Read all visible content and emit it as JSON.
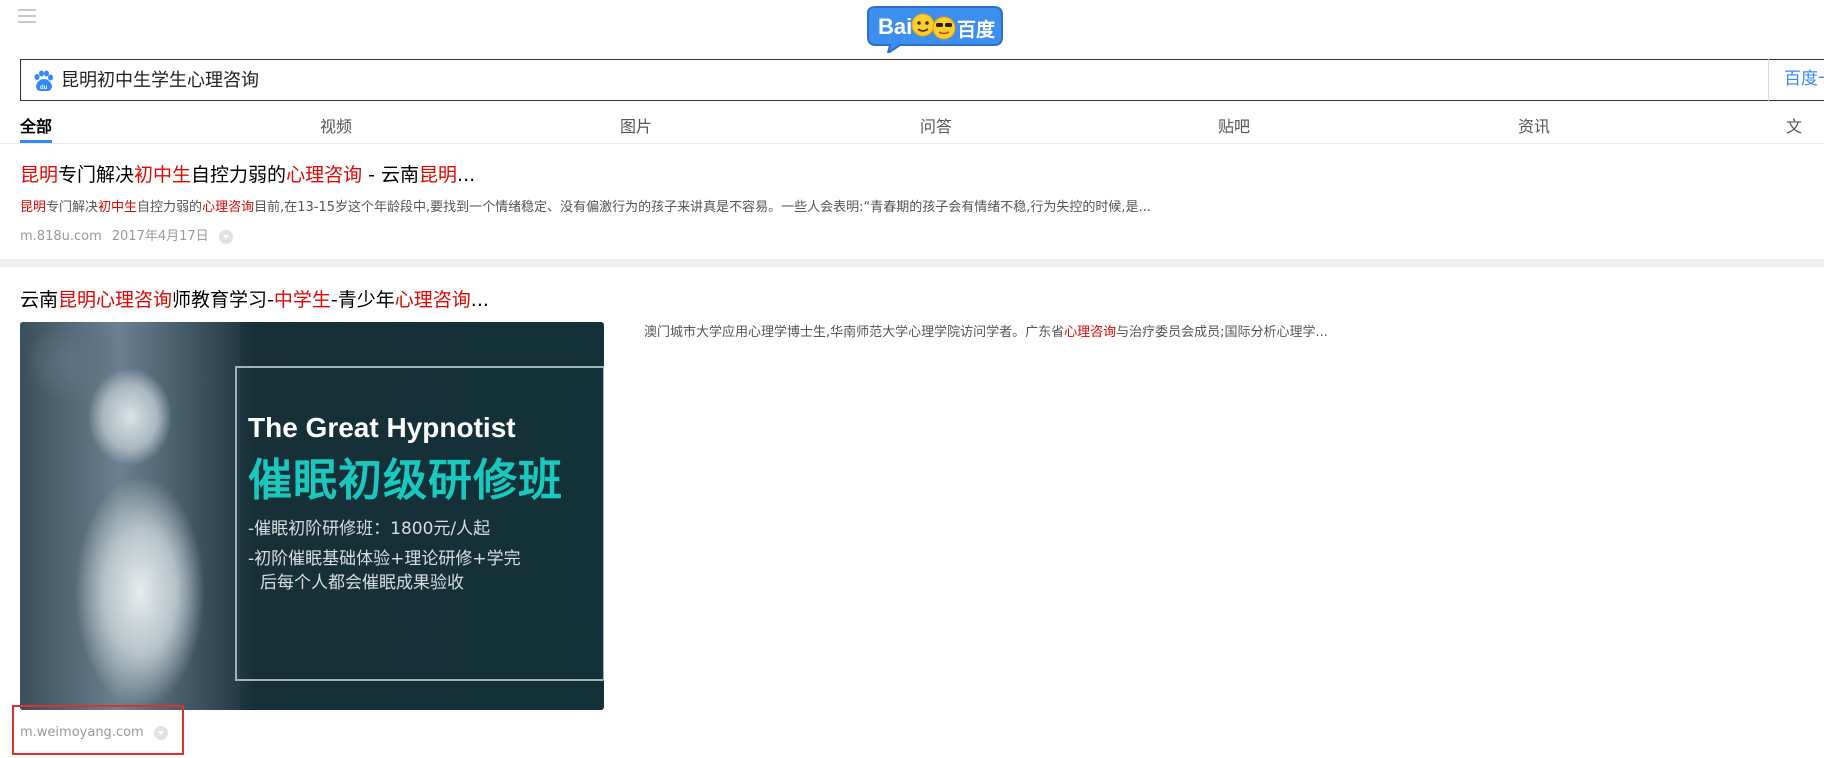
{
  "header": {
    "menu_icon": "hamburger-menu-icon",
    "logo": {
      "latin": "Bai",
      "cn": "百度",
      "colors": {
        "blue": "#3d8fef",
        "yellow": "#ffce2c",
        "white": "#ffffff"
      }
    }
  },
  "search": {
    "query": "昆明初中生学生心理咨询",
    "button_label": "百度一下",
    "icon": "baidu-paw-icon"
  },
  "tabs": [
    {
      "label": "全部",
      "active": true
    },
    {
      "label": "视频"
    },
    {
      "label": "图片"
    },
    {
      "label": "问答"
    },
    {
      "label": "贴吧"
    },
    {
      "label": "资讯"
    },
    {
      "label": "文"
    }
  ],
  "results": [
    {
      "title_parts": [
        {
          "text": "昆明",
          "hl": true
        },
        {
          "text": "专门解决",
          "hl": false
        },
        {
          "text": "初中生",
          "hl": true
        },
        {
          "text": "自控力弱的",
          "hl": false
        },
        {
          "text": "心理咨询",
          "hl": true
        },
        {
          "text": " - 云南",
          "hl": false
        },
        {
          "text": "昆明",
          "hl": true
        },
        {
          "text": "...",
          "hl": false
        }
      ],
      "desc_parts": [
        {
          "text": "昆明",
          "hl": true
        },
        {
          "text": "专门解决",
          "hl": false
        },
        {
          "text": "初中生",
          "hl": true
        },
        {
          "text": "自控力弱的",
          "hl": false
        },
        {
          "text": "心理咨询",
          "hl": true
        },
        {
          "text": "目前,在13-15岁这个年龄段中,要找到一个情绪稳定、没有偏激行为的孩子来讲真是不容易。一些人会表明:“青春期的孩子会有情绪不稳,行为失控的时候,是...",
          "hl": false
        }
      ],
      "site": "m.818u.com",
      "date": "2017年4月17日"
    },
    {
      "title_parts": [
        {
          "text": "云南",
          "hl": false
        },
        {
          "text": "昆明心理咨询",
          "hl": true
        },
        {
          "text": "师教育学习-",
          "hl": false
        },
        {
          "text": "中学生",
          "hl": true
        },
        {
          "text": "-青少年",
          "hl": false
        },
        {
          "text": "心理咨询",
          "hl": true
        },
        {
          "text": "...",
          "hl": false
        }
      ],
      "desc_parts": [
        {
          "text": "澳门城市大学应用心理学博士生,华南师范大学心理学院访问学者。广东省",
          "hl": false
        },
        {
          "text": "心理咨询",
          "hl": true
        },
        {
          "text": "与治疗委员会成员;国际分析心理学...",
          "hl": false
        }
      ],
      "thumbnail": {
        "line1": "The Great Hypnotist",
        "line2": "催眠初级研修班",
        "line3": "-催眠初阶研修班：1800元/人起",
        "line4": "-初阶催眠基础体验+理论研修+学完",
        "line5": "后每个人都会催眠成果验收"
      },
      "site": "m.weimoyang.com"
    }
  ],
  "colors": {
    "highlight": "#e10601",
    "link_blue": "#3388ff",
    "annotation_box": "#e0302a"
  }
}
